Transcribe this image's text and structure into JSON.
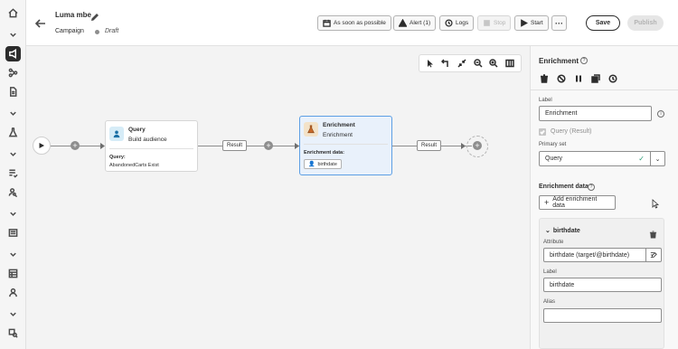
{
  "header": {
    "title": "Luma mbe",
    "subtitle": "Campaign",
    "status": "Draft",
    "buttons": {
      "schedule": "As soon as possible",
      "alert": "Alert (1)",
      "logs": "Logs",
      "stop": "Stop",
      "start": "Start",
      "save": "Save",
      "publish": "Publish"
    }
  },
  "canvas": {
    "query_node": {
      "title": "Query",
      "subtitle": "Build audience",
      "field_label": "Query:",
      "field_value": "AbandonedCarts Exist"
    },
    "enrichment_node": {
      "title": "Enrichment",
      "subtitle": "Enrichment",
      "field_label": "Enrichment data:",
      "chip": "birthdate"
    },
    "result1": "Result",
    "result2": "Result"
  },
  "panel": {
    "title": "Enrichment",
    "label_caption": "Label",
    "label_value": "Enrichment",
    "checkbox_label": "Query (Result)",
    "primary_set_caption": "Primary set",
    "primary_set_value": "Query",
    "section_title": "Enrichment data",
    "add_button": "Add enrichment data",
    "item": {
      "name": "birthdate",
      "attribute_caption": "Attribute",
      "attribute_value": "birthdate (target/@birthdate)",
      "label_caption": "Label",
      "label_value": "birthdate",
      "alias_caption": "Alias",
      "alias_value": ""
    }
  },
  "colors": {
    "accent": "#5d9fe4",
    "check": "#2d9d78",
    "dark": "#2c2c2c"
  }
}
